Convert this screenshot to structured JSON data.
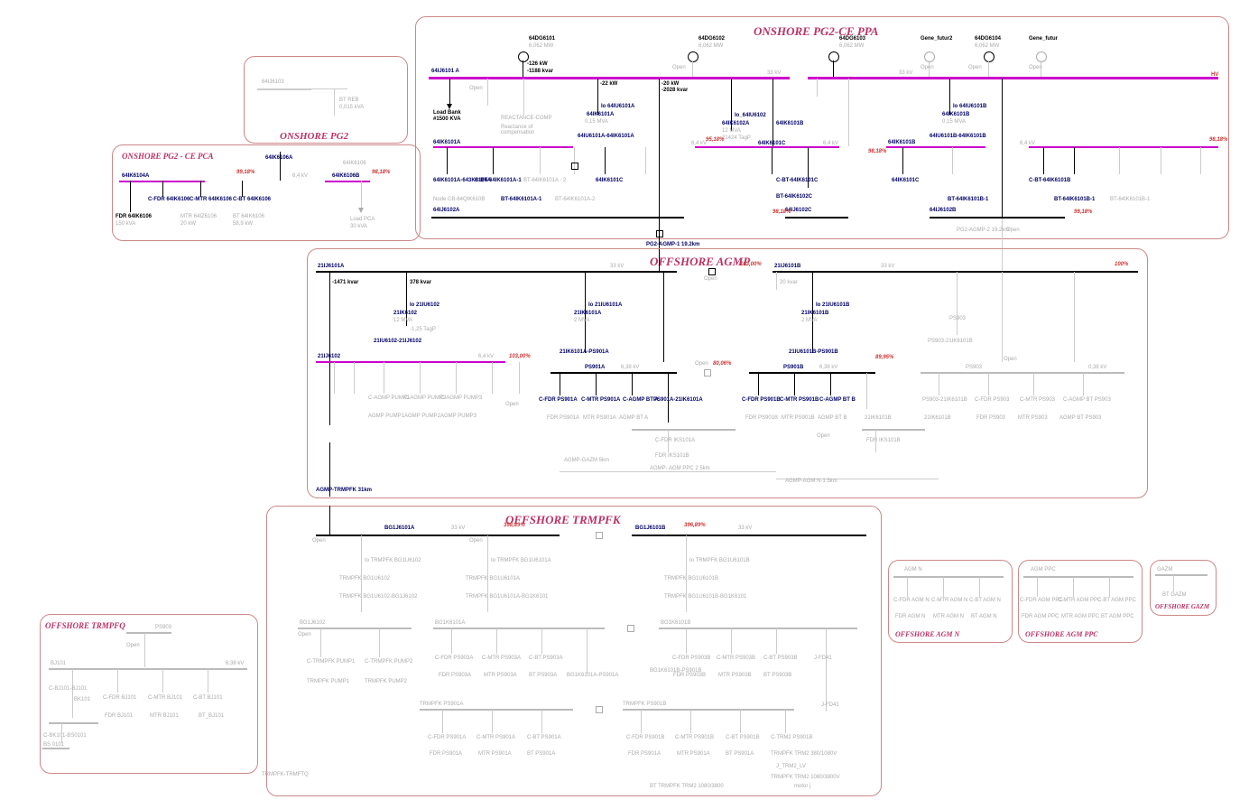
{
  "title_onshore_pg2": "ONSHORE PG2",
  "title_onshore_pg2_ce_ppa": "ONSHORE PG2-CE PPA",
  "title_onshore_pg2_ce_pca": "ONSHORE PG2 - CE PCA",
  "title_offshore_agmp": "OFFSHORE AGMP",
  "title_offshore_trmpfk": "OFFSHORE TRMPFK",
  "title_offshore_trmpfq": "OFFSHORE TRMPFQ",
  "title_offshore_agm_n": "OFFSHORE AGM N",
  "title_offshore_agm_ppc": "OFFSHORE AGM PPC",
  "title_offshore_gazm": "OFFSHORE GAZM",
  "gens": {
    "64DG6101": "64DG6101",
    "64DG6102": "64DG6102",
    "64DG6103": "64DG6103",
    "64DG6104": "64DG6104",
    "gene_futur2": "Gene_futur2",
    "gene_futur": "Gene_futur"
  },
  "gen_mw": "6,062 MW",
  "gen_open": "Open",
  "bus_64IJ6101A": "64IJ6101 A",
  "bus_64IJ6101B": "64IJ6101 B",
  "hv_kv": "HV",
  "load_bank": "Load Bank",
  "load_bank_kva": "#1500 KVA",
  "react_comp": "REACTANCE-COMP",
  "react_comp_sub": "Reactance of compensation",
  "dir_64IU6101A": "Io 64IU6101A",
  "dir_64IU6101B": "Io 64IU6101B",
  "bus_64IK6101A": "64IK6101A",
  "bus_64IK6101B": "64IK6101B",
  "mv_64IU": "0,15 MVA",
  "link_64IU6101A": "64IU6101A-64IK6101A",
  "link_64IU6101B": "64IU6101B-64IK6101B",
  "io_64IU6102": "Io_64IU6102",
  "bus_64IK6102A": "64IK6102A",
  "mv_12": "12 MVA",
  "otagp": "-21424 TagP",
  "bus_64IK6101A_lbl": "64IK6101A",
  "bus_64IK6101B_lbl": "64IK6101B",
  "bus_64IK6101C": "64IK6101C",
  "bus_64IK6102C": "64IK6102C",
  "bus_64IJ6102C": "64IJ6102C",
  "kv_6_4": "6,4 kV",
  "kv_33": "33 kV",
  "loading_99": "99,18%",
  "loading_98": "98,18%",
  "loading_95": "95,18%",
  "flow_22kw": "-22 kW",
  "flow_126kw": "-126 kW",
  "flow_1188": "-1188 kvar",
  "flow_20kw": "-20 kW",
  "flow_2028": "-2028 kvar",
  "node_cb_64Q": "Node CB-64QIK610B",
  "link_64IK6101A_643K6106A": "64IK6101A-643K6106A",
  "cbt_64IK6101A": "C-BT-64IK6101A-1",
  "cbt_64IK6101A2": "BT-64IK6101A - 2",
  "cbt_64IK6101A1": "BT-64IK6101A-1",
  "cbt_64IK6101A3": "BT-64IK6101A-2",
  "cbt_64IK6101B": "C-BT-64IK6101B",
  "cbt_64IK6101B1": "BT-64IK6101B-1",
  "cbt_64IK6101B2": "BT-64IK6101B-1",
  "cbt_64IK6101C": "C-BT-64IK6101C",
  "cbt_64IK6102C": "BT-64IK6102C",
  "bus_64IJ6102A": "64IJ6102A",
  "bus_64IJ6102B": "64IJ6102B",
  "bus_64IK6104A": "64IK6104A",
  "bus_64IK6106A": "64IK6106A",
  "bus_64IK6106B": "64IK6106B",
  "bus_64IK6106": "64IK6106",
  "fdr_64IK6106": "FDR 64IK6106",
  "fdr_64IK6106_sub": "150 kVA",
  "c_fdr_64IK6106": "C-FDR 64IK6106",
  "c_mtr_64IK6106": "C-MTR 64IK6106",
  "mtr_64IK6106": "MTR 64IZ6106",
  "mtr_64IK6106_kw": "20 kW",
  "cbt_64IK6106": "C-BT 64IK6106",
  "bt_64IK6106": "BT 64IK6106",
  "bt_64IK6106_kw": "58,9 kW",
  "load_pca": "Load PCA",
  "load_pca_kva": "30 kVA",
  "bt_reb": "BT REB",
  "bt_reb_kva": "0,015 kVA",
  "cable_pg2_agmp1": "PG2-AGMP-1 19.2km",
  "cable_pg2_agmp2": "PG2-AGMP-2 19.2km",
  "bus_21IJ6101A": "21IJ6101A",
  "bus_21IJ6101B": "21IJ6101B",
  "flow_1471": "-1471 kvar",
  "flow_378": "378 kvar",
  "flow_20kvar": "20 kvar",
  "io_21IU6102": "Io 21IU6102",
  "io_21IU6101A": "Io 21IU6101A",
  "io_21IU6101B": "Io 21IU6101B",
  "bus_21IK6102": "21IK6102",
  "bus_21IK6101A": "21IK6101A",
  "bus_21IK6101B": "21IK6101B",
  "mv_12_2": "12 MVA",
  "mv_2": "2 MVA",
  "tagp_125": "-1,25 TagP",
  "link_21IU6102": "21IU6102-21IJ6102",
  "link_21IK6101A": "21IK6101A-PS901A",
  "link_21IU6101B": "21IU6101B-PS901B",
  "bus_21IJ6102": "21IJ6102",
  "bus_PS901A": "PS901A",
  "bus_PS901B": "PS901B",
  "bus_PS903": "PS903",
  "bus_PS903_sub": "0,38 kV",
  "kv_6_38": "6,38 kV",
  "loading_103": "103,00%",
  "loading_100": "100%",
  "loading_80": "80,06%",
  "loading_89": "89,95%",
  "c_fdr_ps901a": "C-FDR PS901A",
  "c_mtr_ps901a": "C-MTR PS901A",
  "c_agmp_bt_a": "C-AGMP BT A",
  "fdr_ps901a": "FDR PS901A",
  "mtr_ps901a": "MTR PS901A",
  "agmp_bt_a": "AGMP BT A",
  "c_fdr_ps901b": "C-FDR PS901B",
  "c_mtr_ps901b": "C-MTR PS901B",
  "c_agmp_bt_b": "C-AGMP BT B",
  "fdr_ps901b": "FDR PS901B",
  "mtr_ps901b": "MTR PS901B",
  "agmp_bt_b": "AGMP BT B",
  "ps903_21": "PS903-21IK6101B",
  "c_fdr_ps903": "C-FDR PS903",
  "c_mtr_ps903": "C-MTR PS903",
  "c_agmp_bt_ps903": "C-AGMP BT PS903",
  "fdr_ps903": "FDR PS903",
  "mtr_ps903": "MTR PS903",
  "agmp_bt_ps903": "AGMP BT PS903",
  "ps901a_21": "PS901A-21IK6101A",
  "iksb101b": "21IK6101B",
  "c_fdr_iks101a": "C-FDR IKS101A",
  "fdr_iks101b": "FDR IKS101B",
  "c_agmp_pump1": "C-AGMP PUMP1",
  "c_agmp_pump2": "C-AGMP PUMP2",
  "c_agmp_pump3": "C-AGMP PUMP3",
  "agmp_pump1": "AGMP PUMP1",
  "agmp_pump2": "AGMP PUMP2",
  "agmp_pump3": "AGMP PUMP3",
  "agmp_trmpfk": "AGMP-TRMPFK 31km",
  "agmp_agm_ppc2": "AGMP- AGM PPC 2 5km",
  "agmp_gazm": "AGMP-GAZM 5km",
  "agmp_agm": "AGMP-AGM N-1 5km",
  "bus_BG1J6101A": "BG1J6101A",
  "bus_BG1J6101B": "BG1J6101B",
  "loading_390": "398,89%",
  "loading_396": "396,89%",
  "io_trmpfk_bg1u6102": "Io TRMPFK BG1U6102",
  "io_trmpfk_bg1u6101a": "Io TRMPFK BG1U6101A",
  "io_trmpfk_bg1u6101b": "Io TRMPFK BG1U6101B",
  "trmpfk_bg1u6102": "TRMPFK BG1U6102",
  "trmpfk_bg1u6101a": "TRMPFK BG1U6101A",
  "trmpfk_bg1u6101b": "TRMPFK BG1U6101B",
  "link_bg1u6102": "TRMPFK BG1U6102-BG1J6102",
  "link_bg1u6101a": "TRMPFK BG1U6101A-BG1K6101",
  "link_bg1u6101b": "TRMPFK BG1U6101B-BG1K6101",
  "bus_bg1j6102": "BG1J6102",
  "bus_bg1k6101a": "BG1K6101A",
  "bus_bg1k6101b": "BG1K6101B",
  "c_trmpfk_pump1": "C-TRMPFK PUMP1",
  "c_trmpfk_pump2": "C-TRMPFK PUMP2",
  "trmpfk_pump1": "TRMPFK PUMP1",
  "trmpfk_pump2": "TRMPFK PUMP2",
  "c_fdr_ps903a": "C-FDR PS903A",
  "c_mtr_ps903a": "C-MTR PS903A",
  "c_bt_ps903a": "C-BT PS903A",
  "fdr_ps903a": "FDR PS903A",
  "mtr_ps903a": "MTR PS903A",
  "bt_ps903a": "BT PS903A",
  "c_fdr_ps903b": "C-FDR PS903B",
  "c_mtr_ps903b": "C-MTR PS903B",
  "c_bt_ps903b": "C-BT PS903B",
  "fdr_ps903b": "FDR PS903B",
  "mtr_ps903b": "MTR PS903B",
  "bt_ps903b": "BT PS903B",
  "bg1k6101a_ps901a": "BG1K6101A-PS901A",
  "bg1k6101b_ps901b": "BG1K6101B-PS901B",
  "trmpfk_ps901a": "TRMPFK PS901A",
  "trmpfk_ps901b": "TRMPFK PS901B",
  "c_fdr_ps901a2": "C-FDR PS901A",
  "c_mtr_ps901a2": "C-MTR PS901A",
  "c_bt_ps901a": "C-BT PS901A",
  "fdr_ps901a2": "FDR PS901A",
  "mtr_ps901a2": "MTR PS901A",
  "bt_ps901a2": "BT PS901A",
  "c_fdr_ps901b2": "C-FDR PS901B",
  "c_mtr_ps901b2": "C-MTR PS901B",
  "c_bt_ps901b": "C-BT PS901B",
  "c_fdr41": "J-FD41",
  "c_trm2_ps901b": "C-TRM2 PS901B",
  "trmpfk_trm2_380": "TRMPFK TRM2 380/1080V",
  "c_trm2_lv": "J_TRM2_LV",
  "trmpfk_trm2_1080": "TRMPFK TRM2 1080/3800V",
  "bt_trmpfk_trm2": "BT TRMPFK TRM2 1080/3800",
  "motor_j": "motor j",
  "ps903_trmpfq": "PS903",
  "bj101": "BJ101",
  "kv_6_38_2": "6,38 kV",
  "c_bj101": "C-BJ101-BJ101",
  "c_fdr_bj101": "C-FDR BJ101",
  "c_mtr_bj101": "C-MTR BJ101",
  "c_bt_bj101": "C-BT BJ101",
  "bk101": "BK101",
  "fdr_bj101": "FDR BJ101",
  "mtr_bj101": "MTR BJ101",
  "bt_bj101": "BT_BJ101",
  "c_bk101": "C-BK101-BS0101",
  "bs101": "BS 0101",
  "trmpfk_trmpfq": "TRMPFK-TRMFTQ",
  "agm_n": "AGM N",
  "c_fdr_agm_n": "C-FDR AGM N",
  "c_mtr_agm_n": "C-MTR AGM N",
  "c_bt_agm_n": "C-BT AGM N",
  "fdr_agm_n": "FDR AGM N",
  "mtr_agm_n": "MTR AGM N",
  "bt_agm_n": "BT AGM N",
  "agm_ppc": "AGM PPC",
  "c_fdr_agm_ppc": "C-FDR AGM PPC",
  "c_mtr_agm_ppc": "C-MTR AGM PPC",
  "c_bt_agm_ppc": "C-BT AGM PPC",
  "fdr_agm_ppc": "FDR AGM PPC",
  "mtr_agm_ppc": "MTR AGM PPC",
  "bt_agm_ppc": "BT AGM PPC",
  "gazm": "GAZM",
  "bt_gazm": "BT GAZM",
  "64IJ6103": "64IJ6103"
}
